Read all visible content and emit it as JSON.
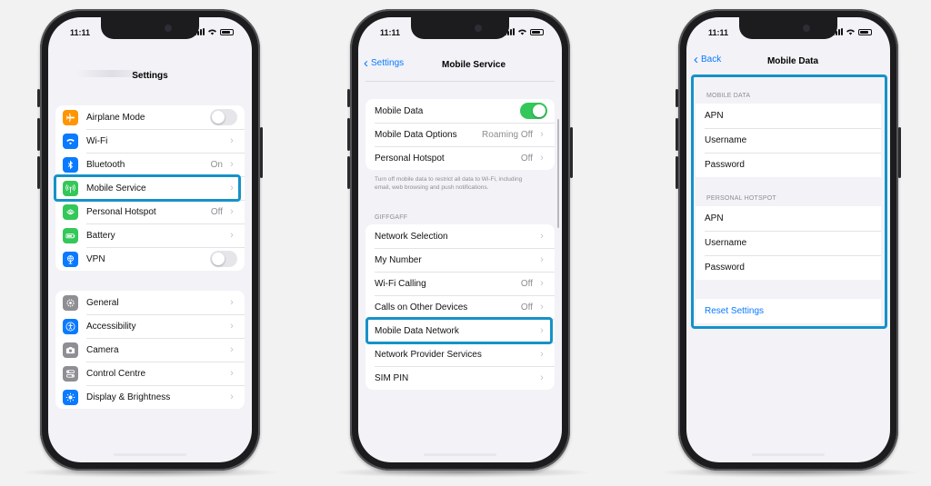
{
  "status": {
    "time": "11:11"
  },
  "screen1": {
    "title": "Settings",
    "group1": [
      {
        "label": "Airplane Mode",
        "icon": "airplane-icon",
        "color": "#ff9500",
        "toggle": false
      },
      {
        "label": "Wi-Fi",
        "icon": "wifi-icon",
        "color": "#0a7aff",
        "value": ""
      },
      {
        "label": "Bluetooth",
        "icon": "bluetooth-icon",
        "color": "#0a7aff",
        "value": "On"
      },
      {
        "label": "Mobile Service",
        "icon": "antenna-icon",
        "color": "#34c759",
        "value": ""
      },
      {
        "label": "Personal Hotspot",
        "icon": "hotspot-icon",
        "color": "#34c759",
        "value": "Off"
      },
      {
        "label": "Battery",
        "icon": "battery-icon",
        "color": "#34c759",
        "value": ""
      },
      {
        "label": "VPN",
        "icon": "vpn-icon",
        "color": "#0a7aff",
        "toggle": false
      }
    ],
    "group2": [
      {
        "label": "General",
        "icon": "gear-icon",
        "color": "#8e8e93"
      },
      {
        "label": "Accessibility",
        "icon": "accessibility-icon",
        "color": "#0a7aff"
      },
      {
        "label": "Camera",
        "icon": "camera-icon",
        "color": "#8e8e93"
      },
      {
        "label": "Control Centre",
        "icon": "control-centre-icon",
        "color": "#8e8e93"
      },
      {
        "label": "Display & Brightness",
        "icon": "sun-icon",
        "color": "#0a7aff"
      }
    ]
  },
  "screen2": {
    "back": "Settings",
    "title": "Mobile Service",
    "group1": [
      {
        "label": "Mobile Data",
        "toggle": true
      },
      {
        "label": "Mobile Data Options",
        "value": "Roaming Off"
      },
      {
        "label": "Personal Hotspot",
        "value": "Off"
      }
    ],
    "footer": "Turn off mobile data to restrict all data to Wi-Fi, including email, web browsing and push notifications.",
    "section": "GIFFGAFF",
    "group2": [
      {
        "label": "Network Selection",
        "value": ""
      },
      {
        "label": "My Number",
        "value": ""
      },
      {
        "label": "Wi-Fi Calling",
        "value": "Off"
      },
      {
        "label": "Calls on Other Devices",
        "value": "Off"
      },
      {
        "label": "Mobile Data Network",
        "value": ""
      },
      {
        "label": "Network Provider Services",
        "value": ""
      },
      {
        "label": "SIM PIN",
        "value": ""
      }
    ]
  },
  "screen3": {
    "back": "Back",
    "title": "Mobile Data",
    "section1": "MOBILE DATA",
    "group1": [
      "APN",
      "Username",
      "Password"
    ],
    "section2": "PERSONAL HOTSPOT",
    "group2": [
      "APN",
      "Username",
      "Password"
    ],
    "reset": "Reset Settings"
  },
  "colors": {
    "highlight": "#1592c8",
    "accent": "#0a7aff",
    "toggle_on": "#34c759"
  }
}
